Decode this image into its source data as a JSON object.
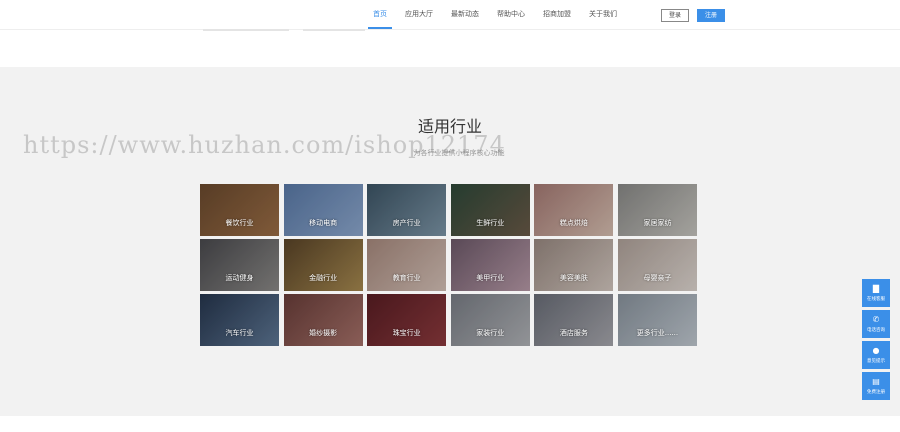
{
  "nav": {
    "items": [
      {
        "label": "首页",
        "active": true
      },
      {
        "label": "应用大厅"
      },
      {
        "label": "最新动态"
      },
      {
        "label": "帮助中心"
      },
      {
        "label": "招商加盟"
      },
      {
        "label": "关于我们"
      }
    ],
    "login_label": "登录",
    "register_label": "注册"
  },
  "industry": {
    "title": "适用行业",
    "subtitle": "为各行业提供小程序核心功能",
    "tiles": [
      {
        "label": "餐饮行业",
        "colors": [
          "#6b4a2e",
          "#9c6e46"
        ]
      },
      {
        "label": "移动电商",
        "colors": [
          "#5a7aa8",
          "#8ea9cf"
        ]
      },
      {
        "label": "房产行业",
        "colors": [
          "#3d5566",
          "#7d96a8"
        ]
      },
      {
        "label": "生鲜行业",
        "colors": [
          "#2e4a3a",
          "#6b5a48"
        ]
      },
      {
        "label": "糕点烘焙",
        "colors": [
          "#a67a74",
          "#d8c0b2"
        ]
      },
      {
        "label": "家居家纺",
        "colors": [
          "#8a8a88",
          "#c8c6c0"
        ]
      },
      {
        "label": "运动健身",
        "colors": [
          "#4a4a4e",
          "#8c8a88"
        ]
      },
      {
        "label": "金融行业",
        "colors": [
          "#5a4428",
          "#a88a50"
        ]
      },
      {
        "label": "教育行业",
        "colors": [
          "#a88a7e",
          "#d6c2b8"
        ]
      },
      {
        "label": "美甲行业",
        "colors": [
          "#6e5a6a",
          "#b89aa8"
        ]
      },
      {
        "label": "美容美肤",
        "colors": [
          "#9a8a82",
          "#d4c8c0"
        ]
      },
      {
        "label": "母婴亲子",
        "colors": [
          "#b0a29a",
          "#e0d8d2"
        ]
      },
      {
        "label": "汽车行业",
        "colors": [
          "#26364e",
          "#5f7896"
        ]
      },
      {
        "label": "婚纱摄影",
        "colors": [
          "#6a3e3a",
          "#a8726a"
        ]
      },
      {
        "label": "珠宝行业",
        "colors": [
          "#5a1e24",
          "#8e3a3e"
        ]
      },
      {
        "label": "家装行业",
        "colors": [
          "#7a7e86",
          "#b2b4b8"
        ]
      },
      {
        "label": "酒店服务",
        "colors": [
          "#6a6e78",
          "#a8a8ae"
        ]
      },
      {
        "label": "更多行业......",
        "colors": [
          "#8a949e",
          "#c2cad2"
        ]
      }
    ]
  },
  "sidebar": {
    "buttons": [
      {
        "label": "在线客服",
        "icon": "chat-icon",
        "glyph": "▇"
      },
      {
        "label": "电话咨询",
        "icon": "phone-icon",
        "glyph": "✆"
      },
      {
        "label": "意见提示",
        "icon": "feedback-icon",
        "glyph": "●"
      },
      {
        "label": "免费注册",
        "icon": "register-icon",
        "glyph": "▤"
      }
    ]
  },
  "watermark": "https://www.huzhan.com/ishop12174",
  "colors": {
    "accent": "#3b8fe8",
    "section_bg": "#f2f2f2"
  }
}
